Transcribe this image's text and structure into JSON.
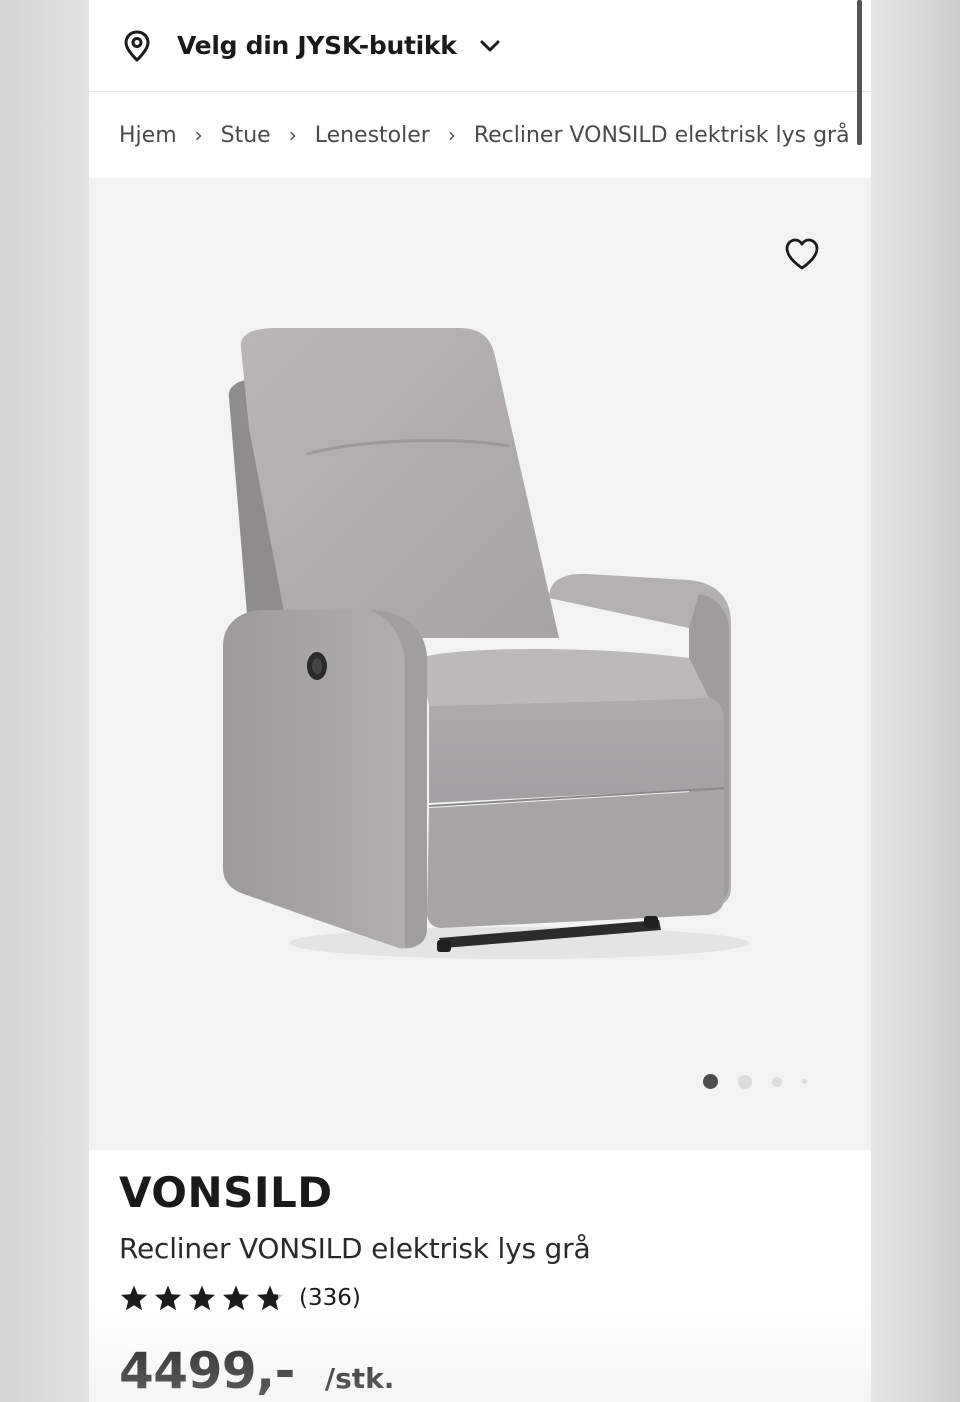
{
  "store_selector": {
    "label": "Velg din JYSK-butikk",
    "icon": "location-pin-icon",
    "chevron_icon": "chevron-down-icon"
  },
  "breadcrumb": {
    "items": [
      "Hjem",
      "Stue",
      "Lenestoler",
      "Recliner VONSILD elektrisk lys grå"
    ],
    "separator": "›"
  },
  "gallery": {
    "favorite_icon": "heart-icon",
    "image_count": 4,
    "active_image": 1
  },
  "product": {
    "brand": "VONSILD",
    "name": "Recliner VONSILD elektrisk lys grå",
    "rating": 4.8,
    "rating_max": 5,
    "review_count": "(336)",
    "price": "4499,-",
    "unit": "/stk."
  },
  "colors": {
    "text": "#1a1a1a",
    "gallery_bg": "#f3f3f3",
    "chair_fabric": "#a9a6a8",
    "dot_active": "#4d4d4d",
    "dot_inactive": "#dcdcdc"
  }
}
